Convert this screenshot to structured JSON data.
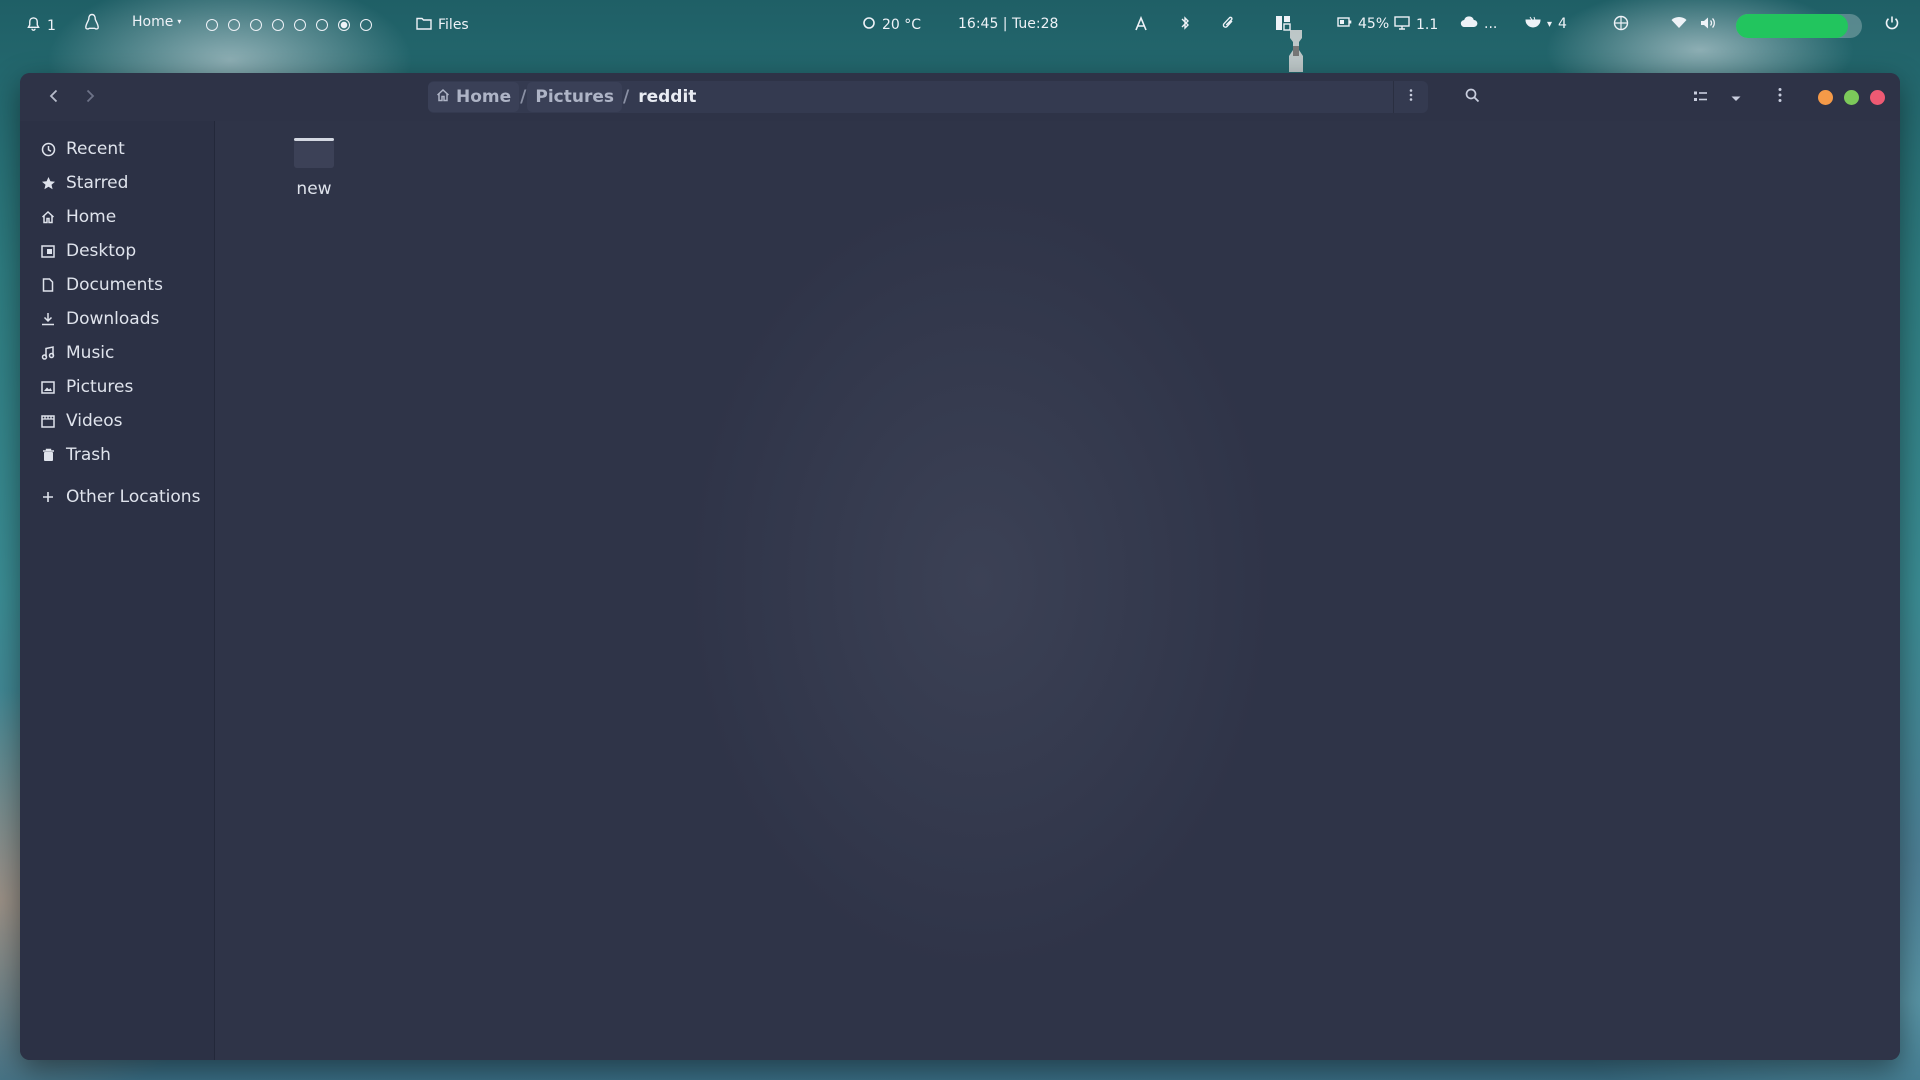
{
  "topbar": {
    "notifications": {
      "icon": "bell-icon",
      "count": "1"
    },
    "distro_icon": "penguin-icon",
    "workspace_label": "Home",
    "workspaces": [
      {
        "active": false
      },
      {
        "active": false
      },
      {
        "active": false
      },
      {
        "active": false
      },
      {
        "active": false
      },
      {
        "active": false
      },
      {
        "active": true
      },
      {
        "active": false
      }
    ],
    "active_app": {
      "icon": "folder-icon",
      "label": "Files"
    },
    "weather": {
      "icon": "weather-icon",
      "text": "20 °C"
    },
    "clock": "16:45 | Tue:28",
    "battery": {
      "icon": "battery-icon",
      "text": "45%"
    },
    "display": {
      "icon": "monitor-icon",
      "text": "1.1"
    },
    "cloud": {
      "icon": "cloud-icon",
      "text": "..."
    },
    "updates": {
      "icon": "bowl-icon",
      "count": "4"
    },
    "progress_fill": 0.89,
    "accent": "#22c55e"
  },
  "window": {
    "path": {
      "home_label": "Home",
      "segments": [
        "Pictures"
      ],
      "current": "reddit",
      "separator": "/"
    },
    "window_controls": {
      "minimize": "#f59a48",
      "maximize": "#7cc95a",
      "close": "#ee5a73"
    }
  },
  "sidebar": {
    "items": [
      {
        "label": "Recent",
        "icon": "clock-icon"
      },
      {
        "label": "Starred",
        "icon": "star-icon"
      },
      {
        "label": "Home",
        "icon": "home-icon"
      },
      {
        "label": "Desktop",
        "icon": "desktop-icon"
      },
      {
        "label": "Documents",
        "icon": "document-icon"
      },
      {
        "label": "Downloads",
        "icon": "download-icon"
      },
      {
        "label": "Music",
        "icon": "music-icon"
      },
      {
        "label": "Pictures",
        "icon": "image-icon"
      },
      {
        "label": "Videos",
        "icon": "video-icon"
      },
      {
        "label": "Trash",
        "icon": "trash-icon"
      }
    ],
    "other_locations": {
      "label": "Other Locations",
      "icon": "plus-icon"
    }
  },
  "content": {
    "files": [
      {
        "name": "new",
        "type": "folder"
      }
    ]
  }
}
